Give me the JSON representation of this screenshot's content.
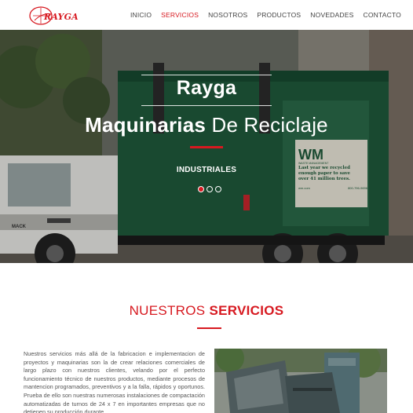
{
  "brand": {
    "logo_text": "RAYGA"
  },
  "nav": {
    "items": [
      "INICIO",
      "SERVICIOS",
      "NOSOTROS",
      "PRODUCTOS",
      "NOVEDADES",
      "CONTACTO"
    ],
    "active": "SERVICIOS"
  },
  "hero": {
    "brand": "Rayga",
    "title_bold": "Maquinarias",
    "title_rest": " De Reciclaje",
    "subtitle": "INDUSTRIALES",
    "truck_logo": "WM",
    "truck_caption": "WASTE MANAGEMENT",
    "truck_text_1": "Last year we recycled",
    "truck_text_2": "enough paper to save",
    "truck_text_3": "over 41 million trees.",
    "truck_url": "wm.com",
    "truck_phone": "800-796-9696",
    "cab_logo": "MACK",
    "slides": 3,
    "active_slide": 1
  },
  "services": {
    "title_light": "NUESTROS ",
    "title_bold": "SERVICIOS",
    "body": "Nuestros servicios más allá de la fabricacion e implementacion de proyectos y maquinarias son la de crear relaciones comerciales de largo plazo con nuestros clientes, velando por el perfecto funcionamiento técnico de nuestros productos, mediante procesos de mantencion programados, preventivos y a la falla, rápidos y oportunos. Prueba de ello son nuestras numerosas instalaciones de compactación automatizadas de turnos de 24 x 7 en importantes empresas que no detienen su producción durante"
  },
  "colors": {
    "accent": "#d71920",
    "nav_text": "#444444",
    "truck_green": "#1f5a3b"
  }
}
